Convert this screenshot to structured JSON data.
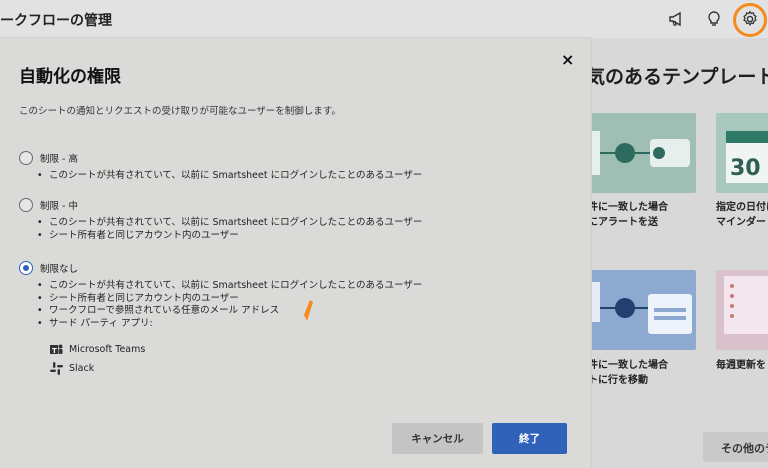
{
  "header": {
    "title": "ークフローの管理",
    "icons": [
      "megaphone-icon",
      "lightbulb-icon",
      "gear-icon"
    ],
    "highlight_color": "#f58a1f"
  },
  "background": {
    "heading": "気のあるテンプレート",
    "tiles": [
      {
        "caption_line1": "条件に一致した場合",
        "caption_line2": "ーにアラートを送"
      },
      {
        "caption_line1": "指定の日付に",
        "caption_line2": "マインダー"
      },
      {
        "caption_line1": "条件に一致した場合",
        "caption_line2": "ートに行を移動"
      },
      {
        "caption_line1": "毎週更新を",
        "caption_line2": ""
      }
    ],
    "tile2_number": "30",
    "more_button": "その他のテ"
  },
  "modal": {
    "title": "自動化の権限",
    "close_label": "×",
    "description": "このシートの通知とリクエストの受け取りが可能なユーザーを制御します。",
    "options": [
      {
        "label": "制限 - 高",
        "checked": false,
        "bullets": [
          "このシートが共有されていて、以前に Smartsheet にログインしたことのあるユーザー"
        ]
      },
      {
        "label": "制限 - 中",
        "checked": false,
        "bullets": [
          "このシートが共有されていて、以前に Smartsheet にログインしたことのあるユーザー",
          "シート所有者と同じアカウント内のユーザー"
        ]
      },
      {
        "label": "制限なし",
        "checked": true,
        "bullets": [
          "このシートが共有されていて、以前に Smartsheet にログインしたことのあるユーザー",
          "シート所有者と同じアカウント内のユーザー",
          "ワークフローで参照されている任意のメール アドレス",
          "サード パーティ アプリ:"
        ]
      }
    ],
    "apps": [
      {
        "name": "Microsoft Teams",
        "icon": "teams-icon"
      },
      {
        "name": "Slack",
        "icon": "slack-icon"
      }
    ],
    "cancel_label": "キャンセル",
    "finish_label": "終了",
    "accent_color": "#2f62b8"
  }
}
